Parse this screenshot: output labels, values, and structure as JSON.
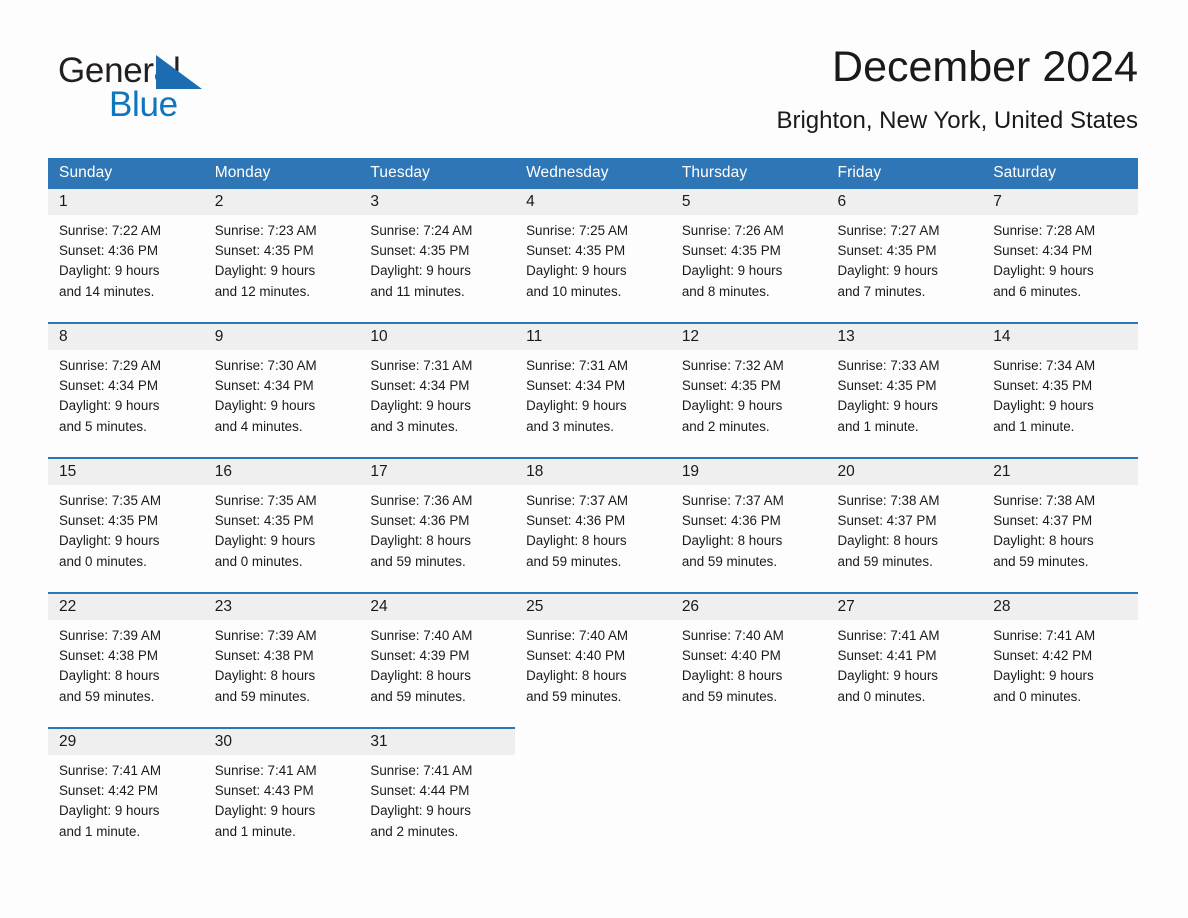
{
  "brand": {
    "name_part1": "General",
    "name_part2": "Blue",
    "triangle_icon": "triangle-logo-icon",
    "accent_color": "#0f75bc"
  },
  "header": {
    "title": "December 2024",
    "subtitle": "Brighton, New York, United States"
  },
  "theme": {
    "header_bg": "#2f76b6",
    "daynum_bg": "#efefef",
    "cell_bg": "#fdfdfd",
    "text_color": "#1a1a1a"
  },
  "weekdays": [
    "Sunday",
    "Monday",
    "Tuesday",
    "Wednesday",
    "Thursday",
    "Friday",
    "Saturday"
  ],
  "weeks": [
    {
      "days": [
        {
          "num": "1",
          "sunrise": "Sunrise: 7:22 AM",
          "sunset": "Sunset: 4:36 PM",
          "daylight1": "Daylight: 9 hours",
          "daylight2": "and 14 minutes."
        },
        {
          "num": "2",
          "sunrise": "Sunrise: 7:23 AM",
          "sunset": "Sunset: 4:35 PM",
          "daylight1": "Daylight: 9 hours",
          "daylight2": "and 12 minutes."
        },
        {
          "num": "3",
          "sunrise": "Sunrise: 7:24 AM",
          "sunset": "Sunset: 4:35 PM",
          "daylight1": "Daylight: 9 hours",
          "daylight2": "and 11 minutes."
        },
        {
          "num": "4",
          "sunrise": "Sunrise: 7:25 AM",
          "sunset": "Sunset: 4:35 PM",
          "daylight1": "Daylight: 9 hours",
          "daylight2": "and 10 minutes."
        },
        {
          "num": "5",
          "sunrise": "Sunrise: 7:26 AM",
          "sunset": "Sunset: 4:35 PM",
          "daylight1": "Daylight: 9 hours",
          "daylight2": "and 8 minutes."
        },
        {
          "num": "6",
          "sunrise": "Sunrise: 7:27 AM",
          "sunset": "Sunset: 4:35 PM",
          "daylight1": "Daylight: 9 hours",
          "daylight2": "and 7 minutes."
        },
        {
          "num": "7",
          "sunrise": "Sunrise: 7:28 AM",
          "sunset": "Sunset: 4:34 PM",
          "daylight1": "Daylight: 9 hours",
          "daylight2": "and 6 minutes."
        }
      ]
    },
    {
      "days": [
        {
          "num": "8",
          "sunrise": "Sunrise: 7:29 AM",
          "sunset": "Sunset: 4:34 PM",
          "daylight1": "Daylight: 9 hours",
          "daylight2": "and 5 minutes."
        },
        {
          "num": "9",
          "sunrise": "Sunrise: 7:30 AM",
          "sunset": "Sunset: 4:34 PM",
          "daylight1": "Daylight: 9 hours",
          "daylight2": "and 4 minutes."
        },
        {
          "num": "10",
          "sunrise": "Sunrise: 7:31 AM",
          "sunset": "Sunset: 4:34 PM",
          "daylight1": "Daylight: 9 hours",
          "daylight2": "and 3 minutes."
        },
        {
          "num": "11",
          "sunrise": "Sunrise: 7:31 AM",
          "sunset": "Sunset: 4:34 PM",
          "daylight1": "Daylight: 9 hours",
          "daylight2": "and 3 minutes."
        },
        {
          "num": "12",
          "sunrise": "Sunrise: 7:32 AM",
          "sunset": "Sunset: 4:35 PM",
          "daylight1": "Daylight: 9 hours",
          "daylight2": "and 2 minutes."
        },
        {
          "num": "13",
          "sunrise": "Sunrise: 7:33 AM",
          "sunset": "Sunset: 4:35 PM",
          "daylight1": "Daylight: 9 hours",
          "daylight2": "and 1 minute."
        },
        {
          "num": "14",
          "sunrise": "Sunrise: 7:34 AM",
          "sunset": "Sunset: 4:35 PM",
          "daylight1": "Daylight: 9 hours",
          "daylight2": "and 1 minute."
        }
      ]
    },
    {
      "days": [
        {
          "num": "15",
          "sunrise": "Sunrise: 7:35 AM",
          "sunset": "Sunset: 4:35 PM",
          "daylight1": "Daylight: 9 hours",
          "daylight2": "and 0 minutes."
        },
        {
          "num": "16",
          "sunrise": "Sunrise: 7:35 AM",
          "sunset": "Sunset: 4:35 PM",
          "daylight1": "Daylight: 9 hours",
          "daylight2": "and 0 minutes."
        },
        {
          "num": "17",
          "sunrise": "Sunrise: 7:36 AM",
          "sunset": "Sunset: 4:36 PM",
          "daylight1": "Daylight: 8 hours",
          "daylight2": "and 59 minutes."
        },
        {
          "num": "18",
          "sunrise": "Sunrise: 7:37 AM",
          "sunset": "Sunset: 4:36 PM",
          "daylight1": "Daylight: 8 hours",
          "daylight2": "and 59 minutes."
        },
        {
          "num": "19",
          "sunrise": "Sunrise: 7:37 AM",
          "sunset": "Sunset: 4:36 PM",
          "daylight1": "Daylight: 8 hours",
          "daylight2": "and 59 minutes."
        },
        {
          "num": "20",
          "sunrise": "Sunrise: 7:38 AM",
          "sunset": "Sunset: 4:37 PM",
          "daylight1": "Daylight: 8 hours",
          "daylight2": "and 59 minutes."
        },
        {
          "num": "21",
          "sunrise": "Sunrise: 7:38 AM",
          "sunset": "Sunset: 4:37 PM",
          "daylight1": "Daylight: 8 hours",
          "daylight2": "and 59 minutes."
        }
      ]
    },
    {
      "days": [
        {
          "num": "22",
          "sunrise": "Sunrise: 7:39 AM",
          "sunset": "Sunset: 4:38 PM",
          "daylight1": "Daylight: 8 hours",
          "daylight2": "and 59 minutes."
        },
        {
          "num": "23",
          "sunrise": "Sunrise: 7:39 AM",
          "sunset": "Sunset: 4:38 PM",
          "daylight1": "Daylight: 8 hours",
          "daylight2": "and 59 minutes."
        },
        {
          "num": "24",
          "sunrise": "Sunrise: 7:40 AM",
          "sunset": "Sunset: 4:39 PM",
          "daylight1": "Daylight: 8 hours",
          "daylight2": "and 59 minutes."
        },
        {
          "num": "25",
          "sunrise": "Sunrise: 7:40 AM",
          "sunset": "Sunset: 4:40 PM",
          "daylight1": "Daylight: 8 hours",
          "daylight2": "and 59 minutes."
        },
        {
          "num": "26",
          "sunrise": "Sunrise: 7:40 AM",
          "sunset": "Sunset: 4:40 PM",
          "daylight1": "Daylight: 8 hours",
          "daylight2": "and 59 minutes."
        },
        {
          "num": "27",
          "sunrise": "Sunrise: 7:41 AM",
          "sunset": "Sunset: 4:41 PM",
          "daylight1": "Daylight: 9 hours",
          "daylight2": "and 0 minutes."
        },
        {
          "num": "28",
          "sunrise": "Sunrise: 7:41 AM",
          "sunset": "Sunset: 4:42 PM",
          "daylight1": "Daylight: 9 hours",
          "daylight2": "and 0 minutes."
        }
      ]
    },
    {
      "days": [
        {
          "num": "29",
          "sunrise": "Sunrise: 7:41 AM",
          "sunset": "Sunset: 4:42 PM",
          "daylight1": "Daylight: 9 hours",
          "daylight2": "and 1 minute."
        },
        {
          "num": "30",
          "sunrise": "Sunrise: 7:41 AM",
          "sunset": "Sunset: 4:43 PM",
          "daylight1": "Daylight: 9 hours",
          "daylight2": "and 1 minute."
        },
        {
          "num": "31",
          "sunrise": "Sunrise: 7:41 AM",
          "sunset": "Sunset: 4:44 PM",
          "daylight1": "Daylight: 9 hours",
          "daylight2": "and 2 minutes."
        },
        {
          "num": "",
          "sunrise": "",
          "sunset": "",
          "daylight1": "",
          "daylight2": ""
        },
        {
          "num": "",
          "sunrise": "",
          "sunset": "",
          "daylight1": "",
          "daylight2": ""
        },
        {
          "num": "",
          "sunrise": "",
          "sunset": "",
          "daylight1": "",
          "daylight2": ""
        },
        {
          "num": "",
          "sunrise": "",
          "sunset": "",
          "daylight1": "",
          "daylight2": ""
        }
      ]
    }
  ]
}
